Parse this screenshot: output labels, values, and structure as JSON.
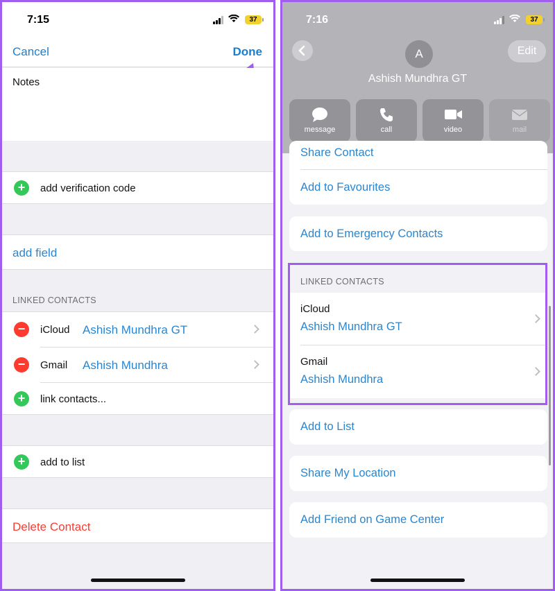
{
  "left": {
    "status": {
      "time": "7:15",
      "battery": "37"
    },
    "nav": {
      "cancel": "Cancel",
      "done": "Done"
    },
    "notes_label": "Notes",
    "verification_label": "add verification code",
    "add_field_label": "add field",
    "linked_header": "LINKED CONTACTS",
    "linked": [
      {
        "service": "iCloud",
        "name": "Ashish Mundhra GT"
      },
      {
        "service": "Gmail",
        "name": "Ashish Mundhra"
      }
    ],
    "link_contacts_label": "link contacts...",
    "add_to_list_label": "add to list",
    "delete_label": "Delete Contact"
  },
  "right": {
    "status": {
      "time": "7:16",
      "battery": "37"
    },
    "avatar_initial": "A",
    "edit_label": "Edit",
    "contact_name": "Ashish Mundhra GT",
    "actions": [
      {
        "label": "message",
        "icon": "message-icon"
      },
      {
        "label": "call",
        "icon": "phone-icon"
      },
      {
        "label": "video",
        "icon": "video-icon"
      },
      {
        "label": "mail",
        "icon": "mail-icon"
      }
    ],
    "share_contact_label": "Share Contact",
    "add_favourites_label": "Add to Favourites",
    "emergency_label": "Add to Emergency Contacts",
    "linked_header": "LINKED CONTACTS",
    "linked": [
      {
        "service": "iCloud",
        "name": "Ashish Mundhra GT"
      },
      {
        "service": "Gmail",
        "name": "Ashish Mundhra"
      }
    ],
    "add_to_list_label": "Add to List",
    "share_location_label": "Share My Location",
    "game_center_label": "Add Friend on Game Center"
  },
  "colors": {
    "accent": "#2a86d0",
    "annotation": "#a05df0",
    "destructive": "#ff3b30",
    "add": "#34c759"
  }
}
